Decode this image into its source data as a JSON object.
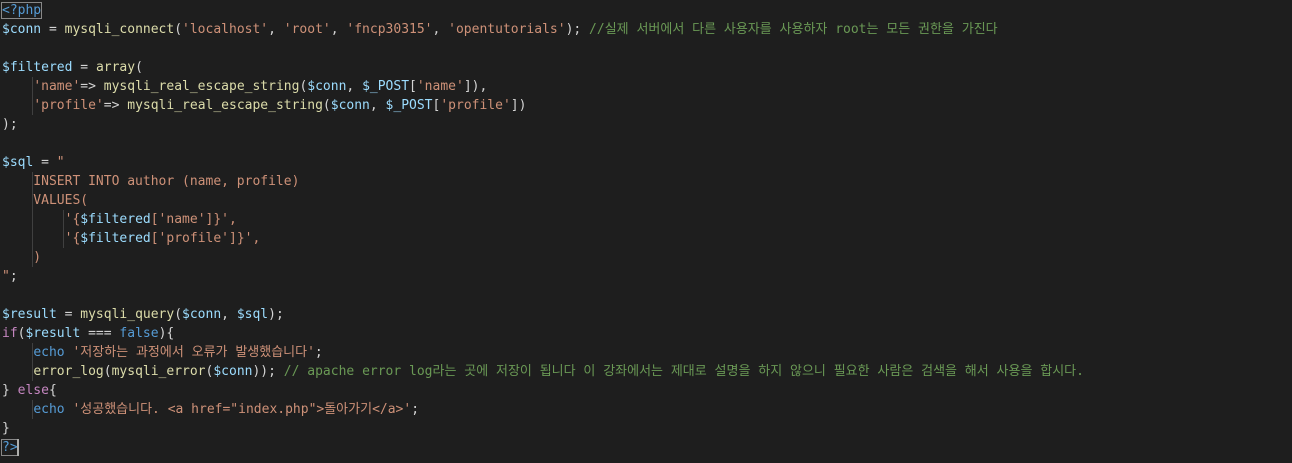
{
  "editor": {
    "language": "php",
    "colors": {
      "background": "#1e1e1e",
      "tag": "#569cd6",
      "variable": "#9cdcfe",
      "function": "#dcdcaa",
      "string": "#ce9178",
      "comment": "#6a9955",
      "keyword": "#c586c0",
      "punctuation": "#d4d4d4"
    },
    "lines": [
      [
        [
          "tag",
          "<?php"
        ]
      ],
      [
        [
          "var",
          "$conn"
        ],
        [
          "pu",
          " = "
        ],
        [
          "fn",
          "mysqli_connect"
        ],
        [
          "pu",
          "("
        ],
        [
          "str",
          "'localhost'"
        ],
        [
          "pu",
          ", "
        ],
        [
          "str",
          "'root'"
        ],
        [
          "pu",
          ", "
        ],
        [
          "str",
          "'fncp30315'"
        ],
        [
          "pu",
          ", "
        ],
        [
          "str",
          "'opentutorials'"
        ],
        [
          "pu",
          "); "
        ],
        [
          "cm",
          "//실제 서버에서 다른 사용자를 사용하자 root는 모든 권한을 가진다"
        ]
      ],
      [],
      [
        [
          "var",
          "$filtered"
        ],
        [
          "pu",
          " = "
        ],
        [
          "fn",
          "array"
        ],
        [
          "pu",
          "("
        ]
      ],
      [
        [
          "pu",
          "    "
        ],
        [
          "str",
          "'name'"
        ],
        [
          "pu",
          "=> "
        ],
        [
          "fn",
          "mysqli_real_escape_string"
        ],
        [
          "pu",
          "("
        ],
        [
          "var",
          "$conn"
        ],
        [
          "pu",
          ", "
        ],
        [
          "var",
          "$_POST"
        ],
        [
          "pu",
          "["
        ],
        [
          "str",
          "'name'"
        ],
        [
          "pu",
          "]),"
        ]
      ],
      [
        [
          "pu",
          "    "
        ],
        [
          "str",
          "'profile'"
        ],
        [
          "pu",
          "=> "
        ],
        [
          "fn",
          "mysqli_real_escape_string"
        ],
        [
          "pu",
          "("
        ],
        [
          "var",
          "$conn"
        ],
        [
          "pu",
          ", "
        ],
        [
          "var",
          "$_POST"
        ],
        [
          "pu",
          "["
        ],
        [
          "str",
          "'profile'"
        ],
        [
          "pu",
          "])"
        ]
      ],
      [
        [
          "pu",
          ");"
        ]
      ],
      [],
      [
        [
          "var",
          "$sql"
        ],
        [
          "pu",
          " = "
        ],
        [
          "str",
          "\""
        ]
      ],
      [
        [
          "str",
          "    INSERT INTO author (name, profile)"
        ]
      ],
      [
        [
          "str",
          "    VALUES("
        ]
      ],
      [
        [
          "str",
          "        '{"
        ],
        [
          "var",
          "$filtered"
        ],
        [
          "str",
          "['name']"
        ],
        [
          "str",
          "}',"
        ]
      ],
      [
        [
          "str",
          "        '{"
        ],
        [
          "var",
          "$filtered"
        ],
        [
          "str",
          "['profile']"
        ],
        [
          "str",
          "}',"
        ]
      ],
      [
        [
          "str",
          "    )"
        ]
      ],
      [
        [
          "str",
          "\""
        ],
        [
          "pu",
          ";"
        ]
      ],
      [],
      [
        [
          "var",
          "$result"
        ],
        [
          "pu",
          " = "
        ],
        [
          "fn",
          "mysqli_query"
        ],
        [
          "pu",
          "("
        ],
        [
          "var",
          "$conn"
        ],
        [
          "pu",
          ", "
        ],
        [
          "var",
          "$sql"
        ],
        [
          "pu",
          ");"
        ]
      ],
      [
        [
          "kw",
          "if"
        ],
        [
          "pu",
          "("
        ],
        [
          "var",
          "$result"
        ],
        [
          "pu",
          " === "
        ],
        [
          "kw2",
          "false"
        ],
        [
          "pu",
          "){"
        ]
      ],
      [
        [
          "pu",
          "    "
        ],
        [
          "kw2",
          "echo"
        ],
        [
          "pu",
          " "
        ],
        [
          "str",
          "'저장하는 과정에서 오류가 발생했습니다'"
        ],
        [
          "pu",
          ";"
        ]
      ],
      [
        [
          "pu",
          "    "
        ],
        [
          "fn",
          "error_log"
        ],
        [
          "pu",
          "("
        ],
        [
          "fn",
          "mysqli_error"
        ],
        [
          "pu",
          "("
        ],
        [
          "var",
          "$conn"
        ],
        [
          "pu",
          ")); "
        ],
        [
          "cm",
          "// apache error log라는 곳에 저장이 됩니다 이 강좌에서는 제대로 설명을 하지 않으니 필요한 사람은 검색을 해서 사용을 합시다."
        ]
      ],
      [
        [
          "pu",
          "} "
        ],
        [
          "kw",
          "else"
        ],
        [
          "pu",
          "{"
        ]
      ],
      [
        [
          "pu",
          "    "
        ],
        [
          "kw2",
          "echo"
        ],
        [
          "pu",
          " "
        ],
        [
          "str",
          "'성공했습니다. <a href=\"index.php\">돌아가기</a>'"
        ],
        [
          "pu",
          ";"
        ]
      ],
      [
        [
          "pu",
          "}"
        ]
      ],
      [
        [
          "tag",
          "?>"
        ]
      ]
    ]
  }
}
